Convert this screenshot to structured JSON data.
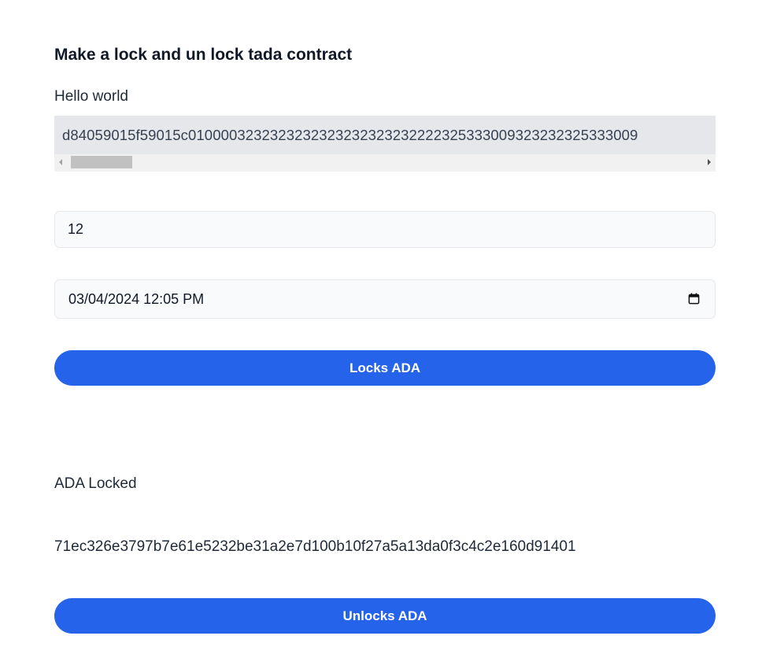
{
  "header": {
    "title": "Make a lock and un lock tada contract"
  },
  "greeting": {
    "text": "Hello world"
  },
  "script_box": {
    "value": "d84059015f59015c0100003232323232323232323232222325333009323232325333009"
  },
  "amount_input": {
    "value": "12"
  },
  "deadline_input": {
    "value": "03/04/2024 12:05 PM"
  },
  "lock_button": {
    "label": "Locks ADA"
  },
  "status": {
    "text": "ADA Locked"
  },
  "transaction": {
    "hash": "71ec326e3797b7e61e5232be31a2e7d100b10f27a5a13da0f3c4c2e160d91401"
  },
  "unlock_button": {
    "label": "Unlocks ADA"
  },
  "colors": {
    "primary": "#2563eb",
    "code_background": "#e5e7eb",
    "input_background": "#f9fafb",
    "text": "#111827"
  },
  "icons": {
    "date_picker": "calendar-icon"
  }
}
